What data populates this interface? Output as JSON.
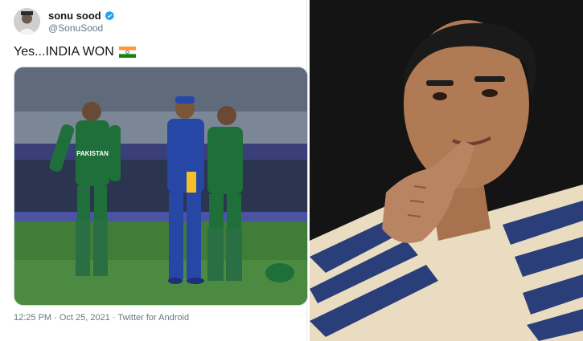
{
  "tweet": {
    "display_name": "sonu sood",
    "handle": "@SonuSood",
    "text": "Yes...INDIA WON",
    "flag": "india-flag",
    "verified_color": "#1da1f2",
    "timestamp": "12:25 PM · Oct 25, 2021 · Twitter for Android",
    "jersey_text": "PAKISTAN"
  },
  "colors": {
    "grass": "#3f7d39",
    "pakistan_green": "#1f6f3b",
    "india_blue": "#2747a6",
    "stripe_blue": "#2a3f7a",
    "stripe_cream": "#e9dcc0"
  }
}
